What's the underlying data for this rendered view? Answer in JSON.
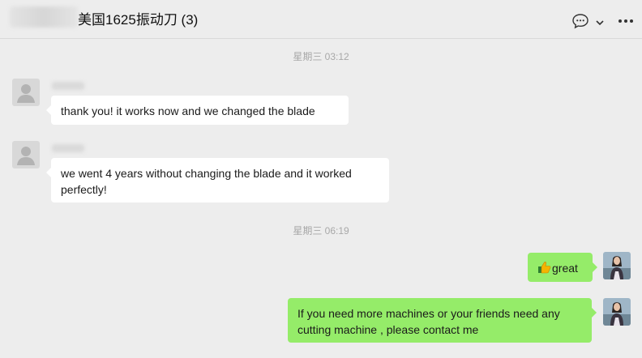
{
  "header": {
    "title": "美国1625振动刀 (3)",
    "icons": [
      "chat-bubble-icon",
      "chevron-down-icon",
      "more-icon"
    ]
  },
  "timestamps": [
    "星期三 03:12",
    "星期三 06:19"
  ],
  "messages": [
    {
      "direction": "incoming",
      "text": "thank you! it works now and we changed the blade"
    },
    {
      "direction": "incoming",
      "text": "we went 4 years without changing the blade and it worked perfectly!"
    },
    {
      "direction": "outgoing",
      "emoji": "thumbs-up-icon",
      "text": "great"
    },
    {
      "direction": "outgoing",
      "text": "If you need more machines or your friends need any cutting machine , please contact me"
    }
  ],
  "colors": {
    "background": "#ededed",
    "incoming_bubble": "#ffffff",
    "outgoing_bubble": "#95ec69",
    "timestamp": "#a8a8a8"
  }
}
